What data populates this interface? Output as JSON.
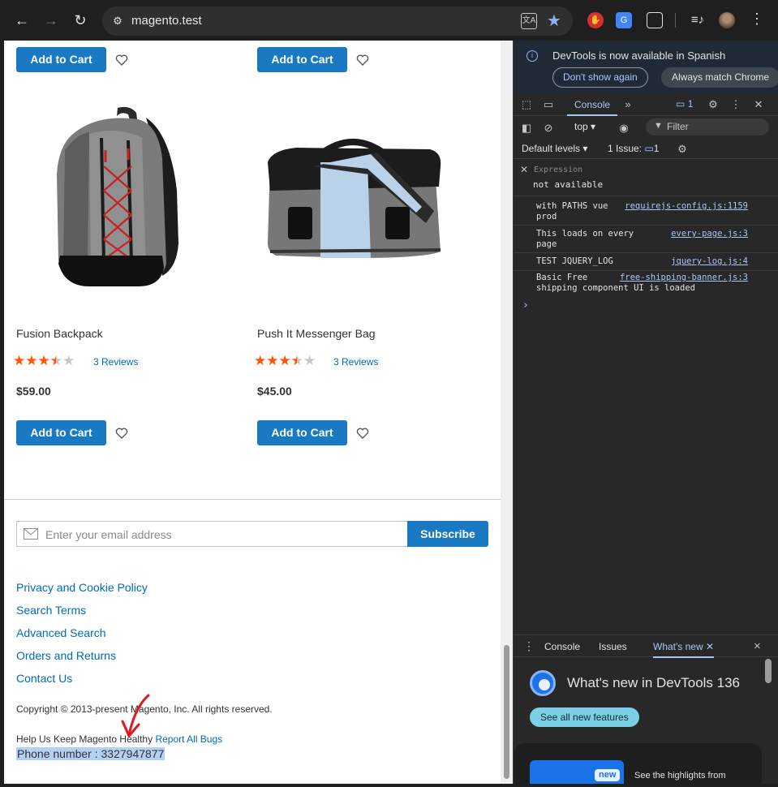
{
  "browser": {
    "url": "magento.test",
    "back_icon": "←",
    "forward_icon": "→",
    "reload_icon": "↻"
  },
  "products_top": [
    {
      "add_to_cart": "Add to Cart"
    },
    {
      "add_to_cart": "Add to Cart"
    }
  ],
  "products": [
    {
      "name": "Fusion Backpack",
      "rating_fraction": 0.7,
      "reviews": "3  Reviews",
      "price": "$59.00",
      "add_to_cart": "Add to Cart"
    },
    {
      "name": "Push It Messenger Bag",
      "rating_fraction": 0.7,
      "reviews": "3  Reviews",
      "price": "$45.00",
      "add_to_cart": "Add to Cart"
    }
  ],
  "newsletter": {
    "placeholder": "Enter your email address",
    "subscribe": "Subscribe"
  },
  "footer": {
    "links": [
      "Privacy and Cookie Policy",
      "Search Terms",
      "Advanced Search",
      "Orders and Returns",
      "Contact Us"
    ],
    "copyright": "Copyright © 2013-present Magento, Inc. All rights reserved.",
    "help_text": "Help Us Keep Magento Healthy",
    "report_link": "Report All Bugs",
    "phone": "Phone number : 3327947877"
  },
  "devtools": {
    "infobar": {
      "message": "DevTools is now available in Spanish",
      "dont_show": "Don't show again",
      "always_match": "Always match Chrome"
    },
    "tabs": {
      "console": "Console",
      "message_count": "1"
    },
    "toolbar": {
      "context": "top",
      "filter_placeholder": "Filter",
      "levels": "Default levels",
      "issues_label": "1 Issue:",
      "issues_count": "1"
    },
    "expression": {
      "label": "Expression",
      "value": "not available"
    },
    "logs": [
      {
        "line1": "with PATHS vue",
        "line2": "prod",
        "source": "requirejs-config.js:1159"
      },
      {
        "line1": "This loads on every",
        "line2": "page",
        "source": "every-page.js:3"
      },
      {
        "line1": "TEST JQUERY_LOG",
        "line2": "",
        "source": "jquery-log.js:4"
      },
      {
        "line1": "Basic Free",
        "line2": "shipping component UI is loaded",
        "source": "free-shipping-banner.js:3"
      }
    ],
    "prompt": "›",
    "drawer": {
      "tabs": [
        "Console",
        "Issues",
        "What's new"
      ],
      "active": "What's new",
      "close": "×"
    },
    "whats_new": {
      "title": "What's new in DevTools 136",
      "button": "See all new features",
      "badge": "new",
      "highlight": "See the highlights from"
    }
  },
  "colors": {
    "magento_blue": "#1979c3",
    "link": "#006bb4",
    "star": "#ff5501",
    "devtools_accent": "#a8c7fa"
  }
}
